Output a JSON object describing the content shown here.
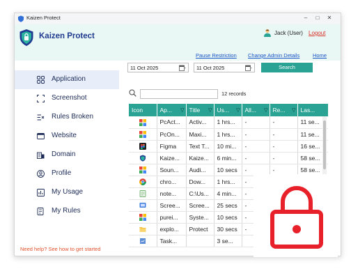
{
  "window": {
    "title": "Kaizen Protect"
  },
  "header": {
    "brand": "Kaizen Protect",
    "user": "Jack (User)",
    "logout": "Logout",
    "links": [
      "Pause Restriction",
      "Change Admin Details",
      "Home"
    ]
  },
  "sidebar": {
    "items": [
      {
        "label": "Application",
        "icon": "apps-grid-icon",
        "active": true
      },
      {
        "label": "Screenshot",
        "icon": "screenshot-icon",
        "active": false
      },
      {
        "label": "Rules Broken",
        "icon": "rules-broken-icon",
        "active": false
      },
      {
        "label": "Website",
        "icon": "website-icon",
        "active": false
      },
      {
        "label": "Domain",
        "icon": "domain-icon",
        "active": false
      },
      {
        "label": "Profile",
        "icon": "profile-icon",
        "active": false
      },
      {
        "label": "My Usage",
        "icon": "usage-icon",
        "active": false
      },
      {
        "label": "My Rules",
        "icon": "rules-icon",
        "active": false
      }
    ],
    "help": "Need help? See how to get started"
  },
  "filters": {
    "from_date": "11 Oct 2025",
    "to_date": "11 Oct 2025",
    "search_label": "Search",
    "records": "12 records"
  },
  "table": {
    "columns": [
      "Icon",
      "Ap...",
      "Title",
      "Us...",
      "All...",
      "Re...",
      "Las..."
    ],
    "rows": [
      {
        "icon": "apps-colorful-icon",
        "cells": [
          "PcAct...",
          "Activ...",
          "1 hrs...",
          "-",
          "-",
          "11 se..."
        ]
      },
      {
        "icon": "apps-colorful-icon",
        "cells": [
          "PcOn...",
          "Maxi...",
          "1 hrs...",
          "-",
          "-",
          "11 se..."
        ]
      },
      {
        "icon": "figma-icon",
        "cells": [
          "Figma",
          "Text T...",
          "10 mi...",
          "-",
          "-",
          "16 se..."
        ]
      },
      {
        "icon": "kaizen-icon",
        "cells": [
          "Kaize...",
          "Kaize...",
          "6 min...",
          "-",
          "-",
          "58 se..."
        ]
      },
      {
        "icon": "apps-colorful-icon",
        "cells": [
          "Soun...",
          "Audi...",
          "10 secs",
          "-",
          "-",
          "58 se..."
        ]
      },
      {
        "icon": "chrome-icon",
        "cells": [
          "chro...",
          "Dow...",
          "1 hrs...",
          "-",
          "-",
          ""
        ]
      },
      {
        "icon": "notepad-icon",
        "cells": [
          "note...",
          "C:\\Us...",
          "4 min...",
          "-",
          "-",
          ""
        ]
      },
      {
        "icon": "screen-icon",
        "cells": [
          "Scree...",
          "Scree...",
          "25 secs",
          "-",
          "-",
          ""
        ]
      },
      {
        "icon": "apps-colorful-icon",
        "cells": [
          "purei...",
          "Syste...",
          "10 secs",
          "-",
          "-",
          ""
        ]
      },
      {
        "icon": "explorer-icon",
        "cells": [
          "explo...",
          "Protect",
          "30 secs",
          "-",
          "-",
          ""
        ]
      },
      {
        "icon": "task-icon",
        "cells": [
          "Task...",
          "",
          "3 se...",
          "",
          "",
          ""
        ]
      }
    ]
  },
  "colors": {
    "accent": "#2aa394",
    "brand": "#1f3b8f",
    "lock": "#e8202a",
    "logout": "#d93025"
  }
}
